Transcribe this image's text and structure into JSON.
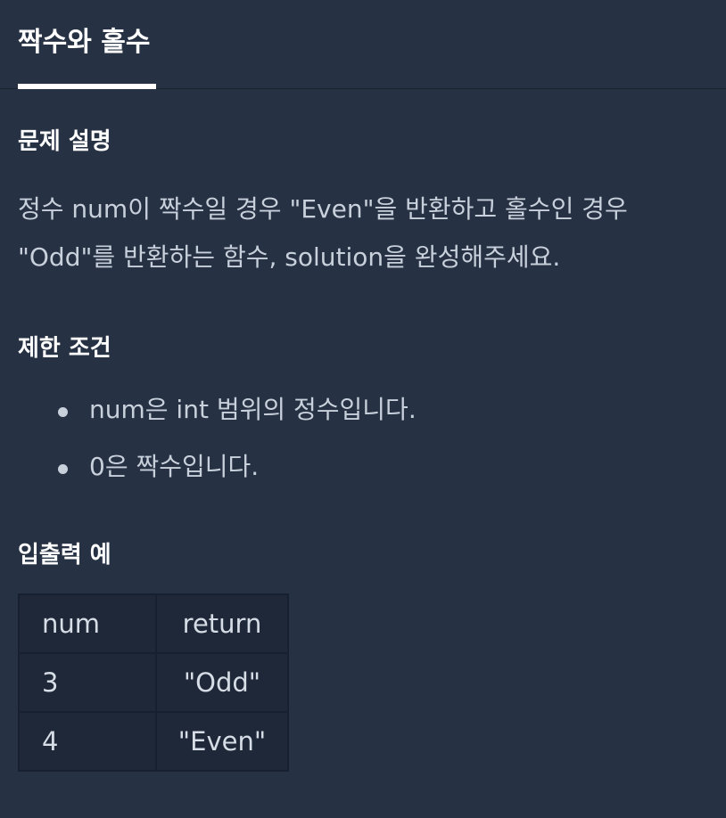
{
  "tab": {
    "label": "짝수와 홀수"
  },
  "sections": {
    "description": {
      "title": "문제 설명",
      "text": "정수 num이 짝수일 경우 \"Even\"을 반환하고 홀수인 경우 \"Odd\"를 반환하는 함수, solution을 완성해주세요."
    },
    "constraints": {
      "title": "제한 조건",
      "items": [
        "num은 int 범위의 정수입니다.",
        "0은 짝수입니다."
      ]
    },
    "examples": {
      "title": "입출력 예",
      "headers": [
        "num",
        "return"
      ],
      "rows": [
        [
          "3",
          "\"Odd\""
        ],
        [
          "4",
          "\"Even\""
        ]
      ]
    }
  }
}
